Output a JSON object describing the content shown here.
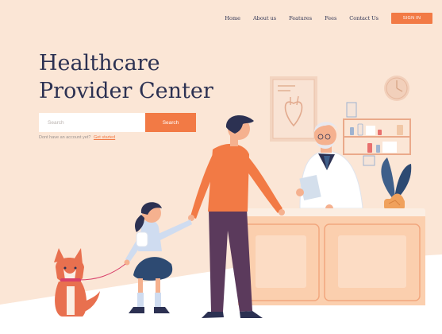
{
  "nav": {
    "items": [
      "Home",
      "About us",
      "Features",
      "Fees",
      "Contact Us"
    ],
    "signin_label": "SIGN IN"
  },
  "hero": {
    "title_line1": "Healthcare",
    "title_line2": "Provider Center"
  },
  "search": {
    "placeholder": "Search",
    "button_label": "Search"
  },
  "signup": {
    "prompt": "Dont have an account yet?",
    "link": "Get started"
  },
  "colors": {
    "accent": "#f27a45",
    "navy": "#2c3152",
    "background": "#fbe6d6"
  }
}
